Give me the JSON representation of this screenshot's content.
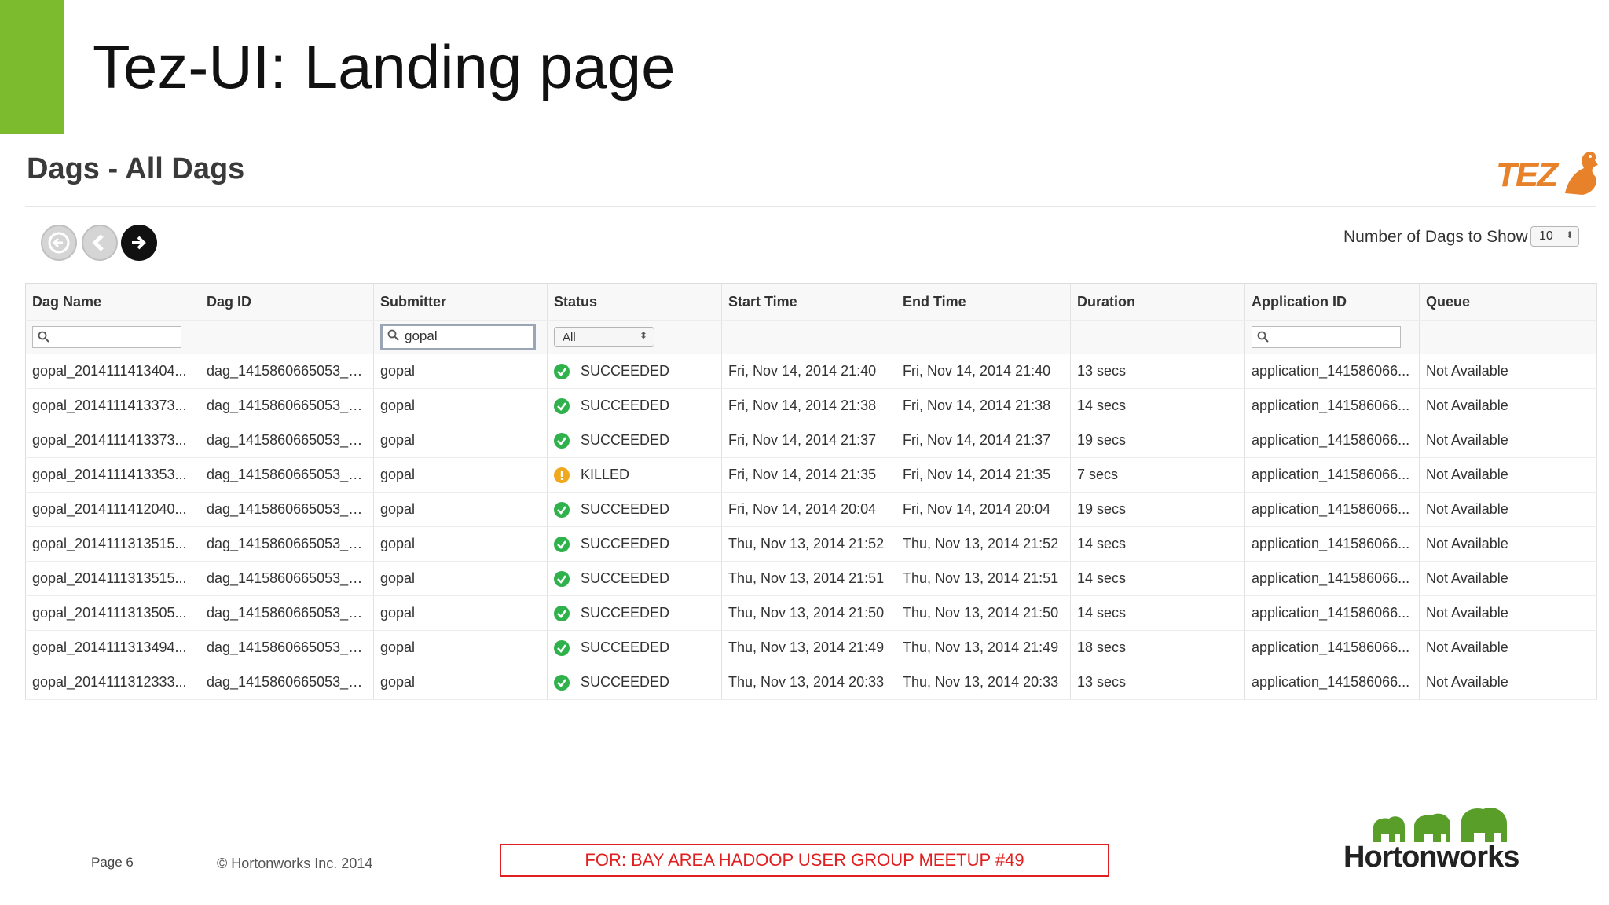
{
  "slide": {
    "title": "Tez-UI: Landing page",
    "page": "Page 6",
    "copyright": "© Hortonworks Inc. 2014",
    "meetup": "FOR: BAY AREA HADOOP USER GROUP MEETUP #49",
    "company_logo": "Hortonworks",
    "accent_color": "#7cbb2e"
  },
  "app": {
    "title": "Dags - All Dags",
    "logo": "TEZ",
    "nav": {
      "first_icon": "first-page-icon",
      "prev_icon": "prev-page-icon",
      "next_icon": "next-page-icon"
    },
    "count_label": "Number of Dags to Show",
    "count_value": "10"
  },
  "table": {
    "columns": [
      "Dag Name",
      "Dag ID",
      "Submitter",
      "Status",
      "Start Time",
      "End Time",
      "Duration",
      "Application ID",
      "Queue"
    ],
    "filters": {
      "dag_name": "",
      "submitter": "gopal",
      "status": "All",
      "application_id": ""
    },
    "rows": [
      {
        "name": "gopal_2014111413404...",
        "id": "dag_1415860665053_0...",
        "submitter": "gopal",
        "status": "SUCCEEDED",
        "start": "Fri, Nov 14, 2014 21:40",
        "end": "Fri, Nov 14, 2014 21:40",
        "duration": "13 secs",
        "app": "application_141586066...",
        "queue": "Not Available"
      },
      {
        "name": "gopal_2014111413373...",
        "id": "dag_1415860665053_0...",
        "submitter": "gopal",
        "status": "SUCCEEDED",
        "start": "Fri, Nov 14, 2014 21:38",
        "end": "Fri, Nov 14, 2014 21:38",
        "duration": "14 secs",
        "app": "application_141586066...",
        "queue": "Not Available"
      },
      {
        "name": "gopal_2014111413373...",
        "id": "dag_1415860665053_0...",
        "submitter": "gopal",
        "status": "SUCCEEDED",
        "start": "Fri, Nov 14, 2014 21:37",
        "end": "Fri, Nov 14, 2014 21:37",
        "duration": "19 secs",
        "app": "application_141586066...",
        "queue": "Not Available"
      },
      {
        "name": "gopal_2014111413353...",
        "id": "dag_1415860665053_0...",
        "submitter": "gopal",
        "status": "KILLED",
        "start": "Fri, Nov 14, 2014 21:35",
        "end": "Fri, Nov 14, 2014 21:35",
        "duration": "7 secs",
        "app": "application_141586066...",
        "queue": "Not Available"
      },
      {
        "name": "gopal_2014111412040...",
        "id": "dag_1415860665053_0...",
        "submitter": "gopal",
        "status": "SUCCEEDED",
        "start": "Fri, Nov 14, 2014 20:04",
        "end": "Fri, Nov 14, 2014 20:04",
        "duration": "19 secs",
        "app": "application_141586066...",
        "queue": "Not Available"
      },
      {
        "name": "gopal_2014111313515...",
        "id": "dag_1415860665053_0...",
        "submitter": "gopal",
        "status": "SUCCEEDED",
        "start": "Thu, Nov 13, 2014 21:52",
        "end": "Thu, Nov 13, 2014 21:52",
        "duration": "14 secs",
        "app": "application_141586066...",
        "queue": "Not Available"
      },
      {
        "name": "gopal_2014111313515...",
        "id": "dag_1415860665053_0...",
        "submitter": "gopal",
        "status": "SUCCEEDED",
        "start": "Thu, Nov 13, 2014 21:51",
        "end": "Thu, Nov 13, 2014 21:51",
        "duration": "14 secs",
        "app": "application_141586066...",
        "queue": "Not Available"
      },
      {
        "name": "gopal_2014111313505...",
        "id": "dag_1415860665053_0...",
        "submitter": "gopal",
        "status": "SUCCEEDED",
        "start": "Thu, Nov 13, 2014 21:50",
        "end": "Thu, Nov 13, 2014 21:50",
        "duration": "14 secs",
        "app": "application_141586066...",
        "queue": "Not Available"
      },
      {
        "name": "gopal_2014111313494...",
        "id": "dag_1415860665053_0...",
        "submitter": "gopal",
        "status": "SUCCEEDED",
        "start": "Thu, Nov 13, 2014 21:49",
        "end": "Thu, Nov 13, 2014 21:49",
        "duration": "18 secs",
        "app": "application_141586066...",
        "queue": "Not Available"
      },
      {
        "name": "gopal_2014111312333...",
        "id": "dag_1415860665053_0...",
        "submitter": "gopal",
        "status": "SUCCEEDED",
        "start": "Thu, Nov 13, 2014 20:33",
        "end": "Thu, Nov 13, 2014 20:33",
        "duration": "13 secs",
        "app": "application_141586066...",
        "queue": "Not Available"
      }
    ]
  }
}
